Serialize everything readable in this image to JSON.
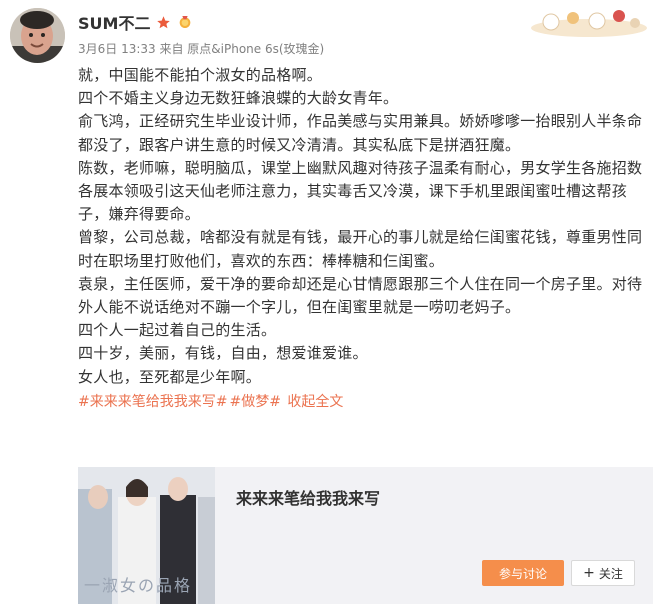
{
  "user": {
    "name": "SUM不二",
    "post_meta": "3月6日 13:33 来自 原点&iPhone 6s(玫瑰金)"
  },
  "post": {
    "paragraphs": [
      "就，中国能不能拍个淑女的品格啊。",
      "四个不婚主义身边无数狂蜂浪蝶的大龄女青年。",
      "俞飞鸿，正经研究生毕业设计师，作品美感与实用兼具。娇娇嗲嗲一抬眼别人半条命都没了，跟客户讲生意的时候又冷清清。其实私底下是拼酒狂魔。",
      "陈数，老师嘛，聪明脑瓜，课堂上幽默风趣对待孩子温柔有耐心，男女学生各施招数各展本领吸引这天仙老师注意力，其实毒舌又冷漠，课下手机里跟闺蜜吐槽这帮孩子，嫌弃得要命。",
      "曾黎，公司总裁，啥都没有就是有钱，最开心的事儿就是给仨闺蜜花钱，尊重男性同时在职场里打败他们，喜欢的东西：棒棒糖和仨闺蜜。",
      "袁泉，主任医师，爱干净的要命却还是心甘情愿跟那三个人住在同一个房子里。对待外人能不说话绝对不蹦一个字儿，但在闺蜜里就是一唠叨老妈子。",
      "四个人一起过着自己的生活。",
      "四十岁，美丽，有钱，自由，想爱谁爱谁。",
      "女人也，至死都是少年啊。"
    ],
    "tags": [
      "#来来来笔给我我来写#",
      "#做梦#"
    ],
    "expand_label": "收起全文"
  },
  "topic_card": {
    "title": "来来来笔给我我来写",
    "poster_caption": "一淑女の品格",
    "join_label": "参与讨论",
    "follow_label": "关注"
  },
  "colors": {
    "accent": "#eb7350",
    "join_button": "#f58e4b",
    "card_bg": "#f2f2f5"
  },
  "icons": {
    "star": "star-icon",
    "badge": "medal-icon",
    "follow": "plus-icon"
  }
}
